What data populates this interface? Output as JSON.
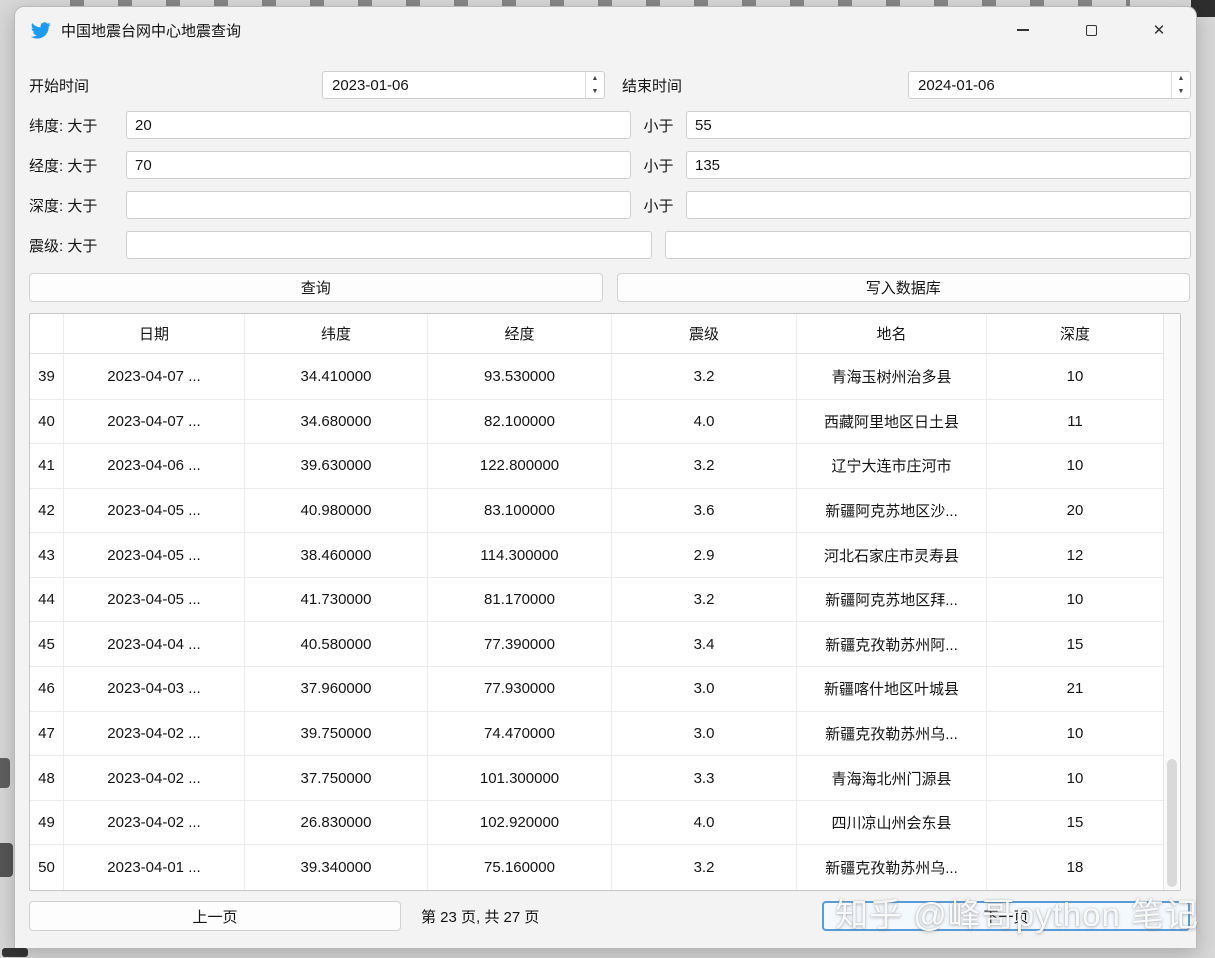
{
  "window": {
    "title": "中国地震台网中心地震查询"
  },
  "filters": {
    "start_time": {
      "label": "开始时间",
      "value": "2023-01-06"
    },
    "end_time": {
      "label": "结束时间",
      "value": "2024-01-06"
    },
    "criteria": [
      {
        "label": "纬度: 大于",
        "min": "20",
        "less_label": "小于",
        "max": "55"
      },
      {
        "label": "经度: 大于",
        "min": "70",
        "less_label": "小于",
        "max": "135"
      },
      {
        "label": "深度: 大于",
        "min": "",
        "less_label": "小于",
        "max": ""
      },
      {
        "label": "震级: 大于",
        "min": "",
        "less_label": "",
        "max": ""
      }
    ]
  },
  "actions": {
    "query": "查询",
    "write_db": "写入数据库"
  },
  "table": {
    "columns": [
      "日期",
      "纬度",
      "经度",
      "震级",
      "地名",
      "深度"
    ],
    "rows": [
      {
        "num": "39",
        "date": "2023-04-07 ...",
        "lat": "34.410000",
        "lon": "93.530000",
        "mag": "3.2",
        "place": "青海玉树州治多县",
        "depth": "10"
      },
      {
        "num": "40",
        "date": "2023-04-07 ...",
        "lat": "34.680000",
        "lon": "82.100000",
        "mag": "4.0",
        "place": "西藏阿里地区日土县",
        "depth": "11"
      },
      {
        "num": "41",
        "date": "2023-04-06 ...",
        "lat": "39.630000",
        "lon": "122.800000",
        "mag": "3.2",
        "place": "辽宁大连市庄河市",
        "depth": "10"
      },
      {
        "num": "42",
        "date": "2023-04-05 ...",
        "lat": "40.980000",
        "lon": "83.100000",
        "mag": "3.6",
        "place": "新疆阿克苏地区沙...",
        "depth": "20"
      },
      {
        "num": "43",
        "date": "2023-04-05 ...",
        "lat": "38.460000",
        "lon": "114.300000",
        "mag": "2.9",
        "place": "河北石家庄市灵寿县",
        "depth": "12"
      },
      {
        "num": "44",
        "date": "2023-04-05 ...",
        "lat": "41.730000",
        "lon": "81.170000",
        "mag": "3.2",
        "place": "新疆阿克苏地区拜...",
        "depth": "10"
      },
      {
        "num": "45",
        "date": "2023-04-04 ...",
        "lat": "40.580000",
        "lon": "77.390000",
        "mag": "3.4",
        "place": "新疆克孜勒苏州阿...",
        "depth": "15"
      },
      {
        "num": "46",
        "date": "2023-04-03 ...",
        "lat": "37.960000",
        "lon": "77.930000",
        "mag": "3.0",
        "place": "新疆喀什地区叶城县",
        "depth": "21"
      },
      {
        "num": "47",
        "date": "2023-04-02 ...",
        "lat": "39.750000",
        "lon": "74.470000",
        "mag": "3.0",
        "place": "新疆克孜勒苏州乌...",
        "depth": "10"
      },
      {
        "num": "48",
        "date": "2023-04-02 ...",
        "lat": "37.750000",
        "lon": "101.300000",
        "mag": "3.3",
        "place": "青海海北州门源县",
        "depth": "10"
      },
      {
        "num": "49",
        "date": "2023-04-02 ...",
        "lat": "26.830000",
        "lon": "102.920000",
        "mag": "4.0",
        "place": "四川凉山州会东县",
        "depth": "15"
      },
      {
        "num": "50",
        "date": "2023-04-01 ...",
        "lat": "39.340000",
        "lon": "75.160000",
        "mag": "3.2",
        "place": "新疆克孜勒苏州乌...",
        "depth": "18"
      }
    ]
  },
  "pagination": {
    "prev": "上一页",
    "info": "第 23 页, 共 27 页",
    "next": "下一页"
  },
  "watermark": "知乎 @峰哥python 笔记",
  "colors": {
    "accent_blue": "#1d9bf0",
    "focus_border": "#5b9bd5"
  }
}
